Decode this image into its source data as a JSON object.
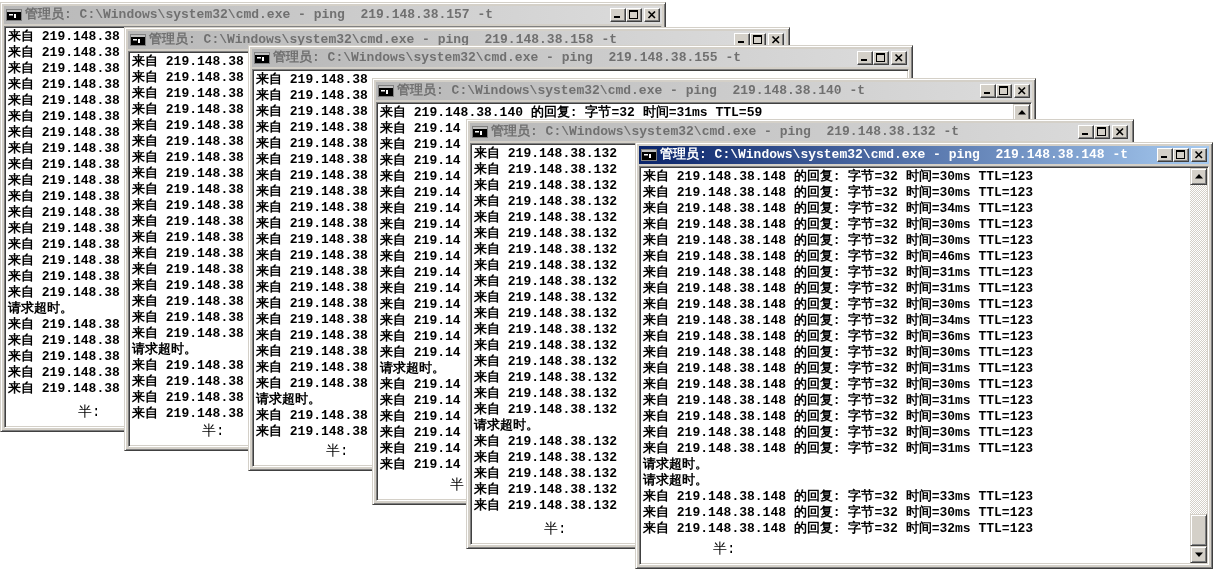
{
  "windows": [
    {
      "title": "管理员: C:\\Windows\\system32\\cmd.exe - ping  219.148.38.157 -t",
      "active": false,
      "scrollbar": false,
      "lines": [
        "来自 219.148.38",
        "来自 219.148.38",
        "来自 219.148.38",
        "来自 219.148.38",
        "来自 219.148.38",
        "来自 219.148.38",
        "来自 219.148.38",
        "来自 219.148.38",
        "来自 219.148.38",
        "来自 219.148.38",
        "来自 219.148.38",
        "来自 219.148.38",
        "来自 219.148.38",
        "来自 219.148.38",
        "来自 219.148.38",
        "来自 219.148.38",
        "来自 219.148.38",
        "请求超时。",
        "来自 219.148.38",
        "来自 219.148.38",
        "来自 219.148.38",
        "来自 219.148.38",
        "来自 219.148.38"
      ],
      "status": "半:"
    },
    {
      "title": "管理员: C:\\Windows\\system32\\cmd.exe - ping  219.148.38.158 -t",
      "active": false,
      "scrollbar": false,
      "lines": [
        "来自 219.148.38",
        "来自 219.148.38",
        "来自 219.148.38",
        "来自 219.148.38",
        "来自 219.148.38",
        "来自 219.148.38",
        "来自 219.148.38",
        "来自 219.148.38",
        "来自 219.148.38",
        "来自 219.148.38",
        "来自 219.148.38",
        "来自 219.148.38",
        "来自 219.148.38",
        "来自 219.148.38",
        "来自 219.148.38",
        "来自 219.148.38",
        "来自 219.148.38",
        "来自 219.148.38",
        "请求超时。",
        "来自 219.148.38",
        "来自 219.148.38",
        "来自 219.148.38",
        "来自 219.148.38"
      ],
      "status": "半:"
    },
    {
      "title": "管理员: C:\\Windows\\system32\\cmd.exe - ping  219.148.38.155 -t",
      "active": false,
      "scrollbar": false,
      "lines": [
        "来自 219.148.38",
        "来自 219.148.38",
        "来自 219.148.38",
        "来自 219.148.38",
        "来自 219.148.38",
        "来自 219.148.38",
        "来自 219.148.38",
        "来自 219.148.38",
        "来自 219.148.38",
        "来自 219.148.38",
        "来自 219.148.38",
        "来自 219.148.38",
        "来自 219.148.38",
        "来自 219.148.38",
        "来自 219.148.38",
        "来自 219.148.38",
        "来自 219.148.38",
        "来自 219.148.38",
        "来自 219.148.38",
        "来自 219.148.38",
        "请求超时。",
        "来自 219.148.38",
        "来自 219.148.38"
      ],
      "status": "半:"
    },
    {
      "title": "管理员: C:\\Windows\\system32\\cmd.exe - ping  219.148.38.140 -t",
      "active": false,
      "scrollbar": true,
      "scroll_thumb": false,
      "lines": [
        "来自 219.148.38.140 的回复: 字节=32 时间=31ms TTL=59",
        "来自 219.14",
        "来自 219.14",
        "来自 219.14",
        "来自 219.14",
        "来自 219.14",
        "来自 219.14",
        "来自 219.14",
        "来自 219.14",
        "来自 219.14",
        "来自 219.14",
        "来自 219.14",
        "来自 219.14",
        "来自 219.14",
        "来自 219.14",
        "来自 219.14",
        "请求超时。",
        "来自 219.14",
        "来自 219.14",
        "来自 219.14",
        "来自 219.14",
        "来自 219.14",
        "来自 219.14"
      ],
      "status": "半"
    },
    {
      "title": "管理员: C:\\Windows\\system32\\cmd.exe - ping  219.148.38.132 -t",
      "active": false,
      "scrollbar": false,
      "lines": [
        "来自 219.148.38.132",
        "来自 219.148.38.132",
        "来自 219.148.38.132",
        "来自 219.148.38.132",
        "来自 219.148.38.132",
        "来自 219.148.38.132",
        "来自 219.148.38.132",
        "来自 219.148.38.132",
        "来自 219.148.38.132",
        "来自 219.148.38.132",
        "来自 219.148.38.132",
        "来自 219.148.38.132",
        "来自 219.148.38.132",
        "来自 219.148.38.132",
        "来自 219.148.38.132",
        "来自 219.148.38.132",
        "来自 219.148.38.132",
        "请求超时。",
        "来自 219.148.38.132",
        "来自 219.148.38.132",
        "来自 219.148.38.132",
        "来自 219.148.38.132",
        "来自 219.148.38.132"
      ],
      "status": "半:"
    },
    {
      "title": "管理员: C:\\Windows\\system32\\cmd.exe - ping  219.148.38.148 -t",
      "active": true,
      "scrollbar": true,
      "scroll_thumb": true,
      "lines": [
        "来自 219.148.38.148 的回复: 字节=32 时间=30ms TTL=123",
        "来自 219.148.38.148 的回复: 字节=32 时间=30ms TTL=123",
        "来自 219.148.38.148 的回复: 字节=32 时间=34ms TTL=123",
        "来自 219.148.38.148 的回复: 字节=32 时间=30ms TTL=123",
        "来自 219.148.38.148 的回复: 字节=32 时间=30ms TTL=123",
        "来自 219.148.38.148 的回复: 字节=32 时间=46ms TTL=123",
        "来自 219.148.38.148 的回复: 字节=32 时间=31ms TTL=123",
        "来自 219.148.38.148 的回复: 字节=32 时间=31ms TTL=123",
        "来自 219.148.38.148 的回复: 字节=32 时间=30ms TTL=123",
        "来自 219.148.38.148 的回复: 字节=32 时间=34ms TTL=123",
        "来自 219.148.38.148 的回复: 字节=32 时间=36ms TTL=123",
        "来自 219.148.38.148 的回复: 字节=32 时间=30ms TTL=123",
        "来自 219.148.38.148 的回复: 字节=32 时间=31ms TTL=123",
        "来自 219.148.38.148 的回复: 字节=32 时间=30ms TTL=123",
        "来自 219.148.38.148 的回复: 字节=32 时间=31ms TTL=123",
        "来自 219.148.38.148 的回复: 字节=32 时间=30ms TTL=123",
        "来自 219.148.38.148 的回复: 字节=32 时间=30ms TTL=123",
        "来自 219.148.38.148 的回复: 字节=32 时间=31ms TTL=123",
        "请求超时。",
        "请求超时。",
        "来自 219.148.38.148 的回复: 字节=32 时间=33ms TTL=123",
        "来自 219.148.38.148 的回复: 字节=32 时间=30ms TTL=123",
        "来自 219.148.38.148 的回复: 字节=32 时间=32ms TTL=123"
      ],
      "status": "半:"
    }
  ]
}
